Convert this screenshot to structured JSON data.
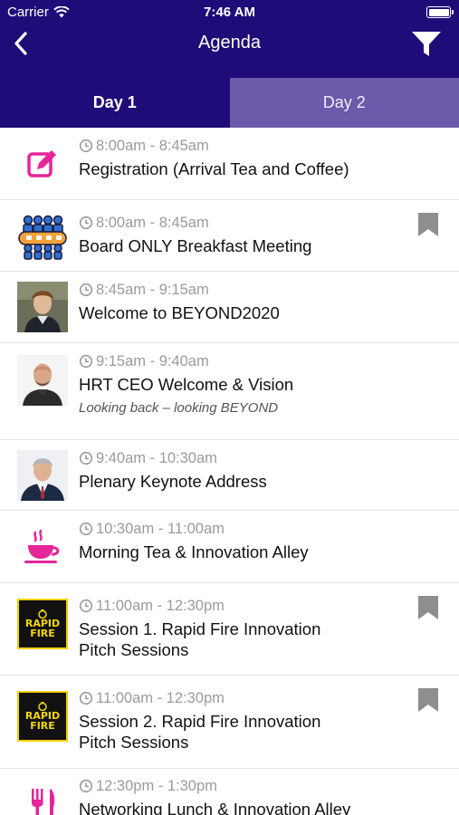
{
  "status_bar": {
    "carrier": "Carrier",
    "time": "7:46 AM"
  },
  "nav": {
    "title": "Agenda"
  },
  "tabs": [
    {
      "label": "Day 1"
    },
    {
      "label": "Day 2"
    }
  ],
  "colors": {
    "header": "#1f0c78",
    "tab_inactive": "#6a5aa9",
    "accent_pink": "#e5259a",
    "muted": "#9a9a9a"
  },
  "agenda": [
    {
      "time": "8:00am - 8:45am",
      "title": "Registration (Arrival Tea and Coffee)",
      "icon": "edit-icon"
    },
    {
      "time": "8:00am - 8:45am",
      "title": "Board ONLY Breakfast Meeting",
      "icon": "board-meeting-icon",
      "bookmark": true
    },
    {
      "time": "8:45am - 9:15am",
      "title": "Welcome to BEYOND2020",
      "icon": "speaker-photo"
    },
    {
      "time": "9:15am - 9:40am",
      "title": "HRT CEO Welcome & Vision",
      "subtitle": "Looking back – looking BEYOND",
      "icon": "speaker-photo"
    },
    {
      "time": "9:40am - 10:30am",
      "title": "Plenary Keynote Address",
      "icon": "speaker-photo"
    },
    {
      "time": "10:30am - 11:00am",
      "title": "Morning Tea & Innovation Alley",
      "icon": "coffee-cup-icon"
    },
    {
      "time": "11:00am - 12:30pm",
      "title_lines": [
        "Session 1. Rapid Fire Innovation",
        "Pitch Sessions"
      ],
      "icon": "rapid-fire-logo",
      "bookmark": true
    },
    {
      "time": "11:00am - 12:30pm",
      "title_lines": [
        "Session 2. Rapid Fire Innovation",
        "Pitch Sessions"
      ],
      "icon": "rapid-fire-logo",
      "bookmark": true
    },
    {
      "time": "12:30pm - 1:30pm",
      "title": "Networking Lunch & Innovation Alley",
      "icon": "cutlery-icon"
    }
  ],
  "rapid_fire_logo": {
    "line1": "RAPID",
    "line2": "FIRE"
  }
}
